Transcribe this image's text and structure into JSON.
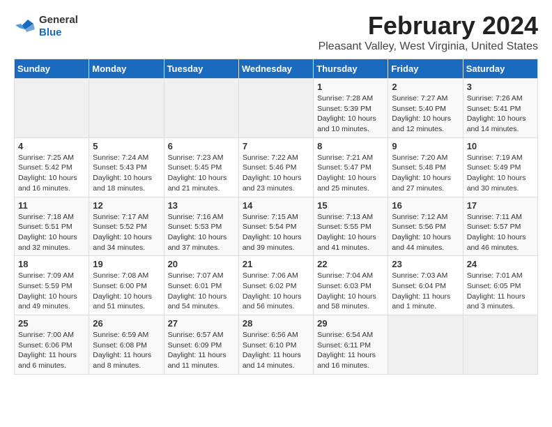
{
  "logo": {
    "general": "General",
    "blue": "Blue"
  },
  "title": "February 2024",
  "subtitle": "Pleasant Valley, West Virginia, United States",
  "days_of_week": [
    "Sunday",
    "Monday",
    "Tuesday",
    "Wednesday",
    "Thursday",
    "Friday",
    "Saturday"
  ],
  "weeks": [
    [
      {
        "day": "",
        "detail": ""
      },
      {
        "day": "",
        "detail": ""
      },
      {
        "day": "",
        "detail": ""
      },
      {
        "day": "",
        "detail": ""
      },
      {
        "day": "1",
        "detail": "Sunrise: 7:28 AM\nSunset: 5:39 PM\nDaylight: 10 hours\nand 10 minutes."
      },
      {
        "day": "2",
        "detail": "Sunrise: 7:27 AM\nSunset: 5:40 PM\nDaylight: 10 hours\nand 12 minutes."
      },
      {
        "day": "3",
        "detail": "Sunrise: 7:26 AM\nSunset: 5:41 PM\nDaylight: 10 hours\nand 14 minutes."
      }
    ],
    [
      {
        "day": "4",
        "detail": "Sunrise: 7:25 AM\nSunset: 5:42 PM\nDaylight: 10 hours\nand 16 minutes."
      },
      {
        "day": "5",
        "detail": "Sunrise: 7:24 AM\nSunset: 5:43 PM\nDaylight: 10 hours\nand 18 minutes."
      },
      {
        "day": "6",
        "detail": "Sunrise: 7:23 AM\nSunset: 5:45 PM\nDaylight: 10 hours\nand 21 minutes."
      },
      {
        "day": "7",
        "detail": "Sunrise: 7:22 AM\nSunset: 5:46 PM\nDaylight: 10 hours\nand 23 minutes."
      },
      {
        "day": "8",
        "detail": "Sunrise: 7:21 AM\nSunset: 5:47 PM\nDaylight: 10 hours\nand 25 minutes."
      },
      {
        "day": "9",
        "detail": "Sunrise: 7:20 AM\nSunset: 5:48 PM\nDaylight: 10 hours\nand 27 minutes."
      },
      {
        "day": "10",
        "detail": "Sunrise: 7:19 AM\nSunset: 5:49 PM\nDaylight: 10 hours\nand 30 minutes."
      }
    ],
    [
      {
        "day": "11",
        "detail": "Sunrise: 7:18 AM\nSunset: 5:51 PM\nDaylight: 10 hours\nand 32 minutes."
      },
      {
        "day": "12",
        "detail": "Sunrise: 7:17 AM\nSunset: 5:52 PM\nDaylight: 10 hours\nand 34 minutes."
      },
      {
        "day": "13",
        "detail": "Sunrise: 7:16 AM\nSunset: 5:53 PM\nDaylight: 10 hours\nand 37 minutes."
      },
      {
        "day": "14",
        "detail": "Sunrise: 7:15 AM\nSunset: 5:54 PM\nDaylight: 10 hours\nand 39 minutes."
      },
      {
        "day": "15",
        "detail": "Sunrise: 7:13 AM\nSunset: 5:55 PM\nDaylight: 10 hours\nand 41 minutes."
      },
      {
        "day": "16",
        "detail": "Sunrise: 7:12 AM\nSunset: 5:56 PM\nDaylight: 10 hours\nand 44 minutes."
      },
      {
        "day": "17",
        "detail": "Sunrise: 7:11 AM\nSunset: 5:57 PM\nDaylight: 10 hours\nand 46 minutes."
      }
    ],
    [
      {
        "day": "18",
        "detail": "Sunrise: 7:09 AM\nSunset: 5:59 PM\nDaylight: 10 hours\nand 49 minutes."
      },
      {
        "day": "19",
        "detail": "Sunrise: 7:08 AM\nSunset: 6:00 PM\nDaylight: 10 hours\nand 51 minutes."
      },
      {
        "day": "20",
        "detail": "Sunrise: 7:07 AM\nSunset: 6:01 PM\nDaylight: 10 hours\nand 54 minutes."
      },
      {
        "day": "21",
        "detail": "Sunrise: 7:06 AM\nSunset: 6:02 PM\nDaylight: 10 hours\nand 56 minutes."
      },
      {
        "day": "22",
        "detail": "Sunrise: 7:04 AM\nSunset: 6:03 PM\nDaylight: 10 hours\nand 58 minutes."
      },
      {
        "day": "23",
        "detail": "Sunrise: 7:03 AM\nSunset: 6:04 PM\nDaylight: 11 hours\nand 1 minute."
      },
      {
        "day": "24",
        "detail": "Sunrise: 7:01 AM\nSunset: 6:05 PM\nDaylight: 11 hours\nand 3 minutes."
      }
    ],
    [
      {
        "day": "25",
        "detail": "Sunrise: 7:00 AM\nSunset: 6:06 PM\nDaylight: 11 hours\nand 6 minutes."
      },
      {
        "day": "26",
        "detail": "Sunrise: 6:59 AM\nSunset: 6:08 PM\nDaylight: 11 hours\nand 8 minutes."
      },
      {
        "day": "27",
        "detail": "Sunrise: 6:57 AM\nSunset: 6:09 PM\nDaylight: 11 hours\nand 11 minutes."
      },
      {
        "day": "28",
        "detail": "Sunrise: 6:56 AM\nSunset: 6:10 PM\nDaylight: 11 hours\nand 14 minutes."
      },
      {
        "day": "29",
        "detail": "Sunrise: 6:54 AM\nSunset: 6:11 PM\nDaylight: 11 hours\nand 16 minutes."
      },
      {
        "day": "",
        "detail": ""
      },
      {
        "day": "",
        "detail": ""
      }
    ]
  ]
}
